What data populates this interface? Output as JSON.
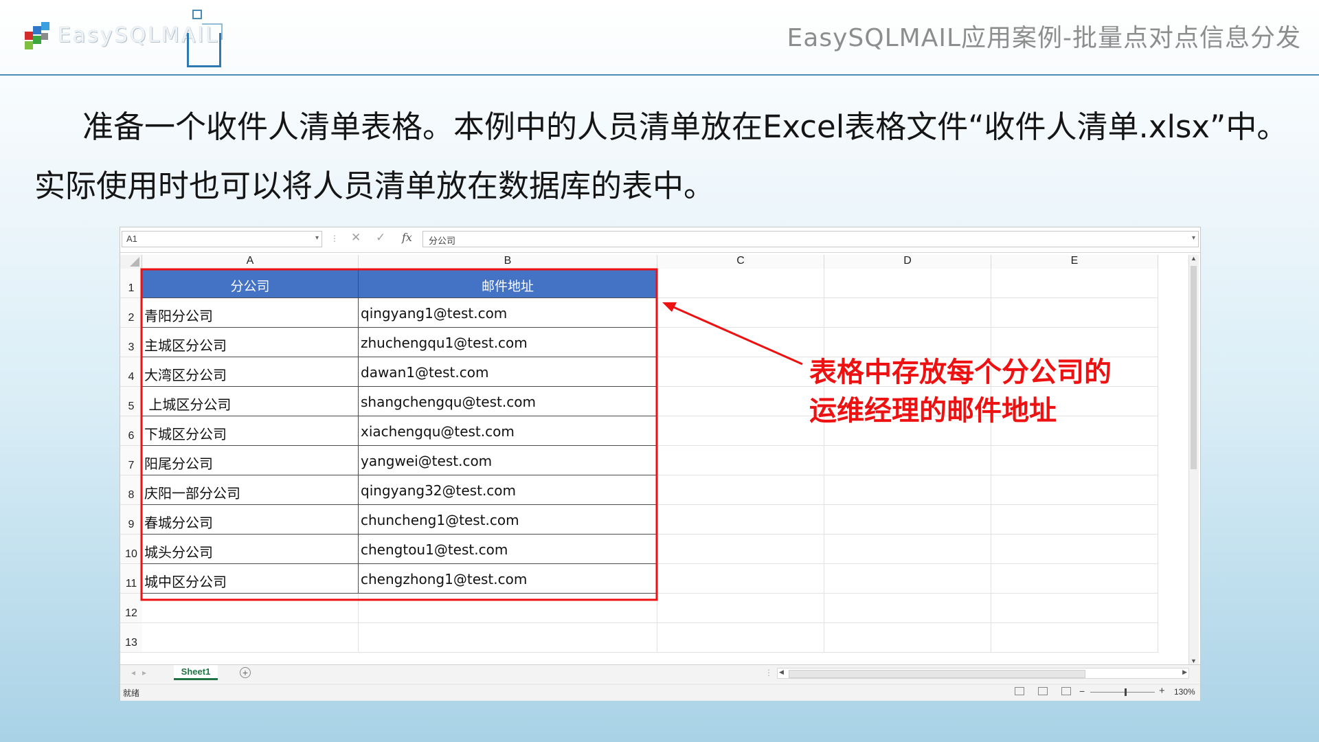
{
  "header": {
    "logo_text": "EasySQLMAIL",
    "title": "EasySQLMAIL应用案例-批量点对点信息分发"
  },
  "intro_text": "准备一个收件人清单表格。本例中的人员清单放在Excel表格文件“收件人清单.xlsx”中。实际使用时也可以将人员清单放在数据库的表中。",
  "excel": {
    "name_box": "A1",
    "formula": "分公司",
    "columns": [
      "A",
      "B",
      "C",
      "D",
      "E"
    ],
    "rows": [
      "1",
      "2",
      "3",
      "4",
      "5",
      "6",
      "7",
      "8",
      "9",
      "10",
      "11",
      "12",
      "13"
    ],
    "table": {
      "headers": [
        "分公司",
        "邮件地址"
      ],
      "rows": [
        [
          "青阳分公司",
          "qingyang1@test.com"
        ],
        [
          "主城区分公司",
          "zhuchengqu1@test.com"
        ],
        [
          "大湾区分公司",
          "dawan1@test.com"
        ],
        [
          " 上城区分公司",
          "shangchengqu@test.com"
        ],
        [
          "下城区分公司",
          "xiachengqu@test.com"
        ],
        [
          "阳尾分公司",
          "yangwei@test.com"
        ],
        [
          "庆阳一部分公司",
          "qingyang32@test.com"
        ],
        [
          "春城分公司",
          "chuncheng1@test.com"
        ],
        [
          "城头分公司",
          "chengtou1@test.com"
        ],
        [
          "城中区分公司",
          "chengzhong1@test.com"
        ]
      ]
    },
    "sheet_tab": "Sheet1",
    "status": "就绪",
    "zoom": "130%"
  },
  "callout": {
    "line1": "表格中存放每个分公司的",
    "line2": "运维经理的邮件地址",
    "color": "#ee1111"
  },
  "colors": {
    "header_fill": "#4472c4",
    "rule": "#4b8db8",
    "sheet_tab": "#217346"
  }
}
